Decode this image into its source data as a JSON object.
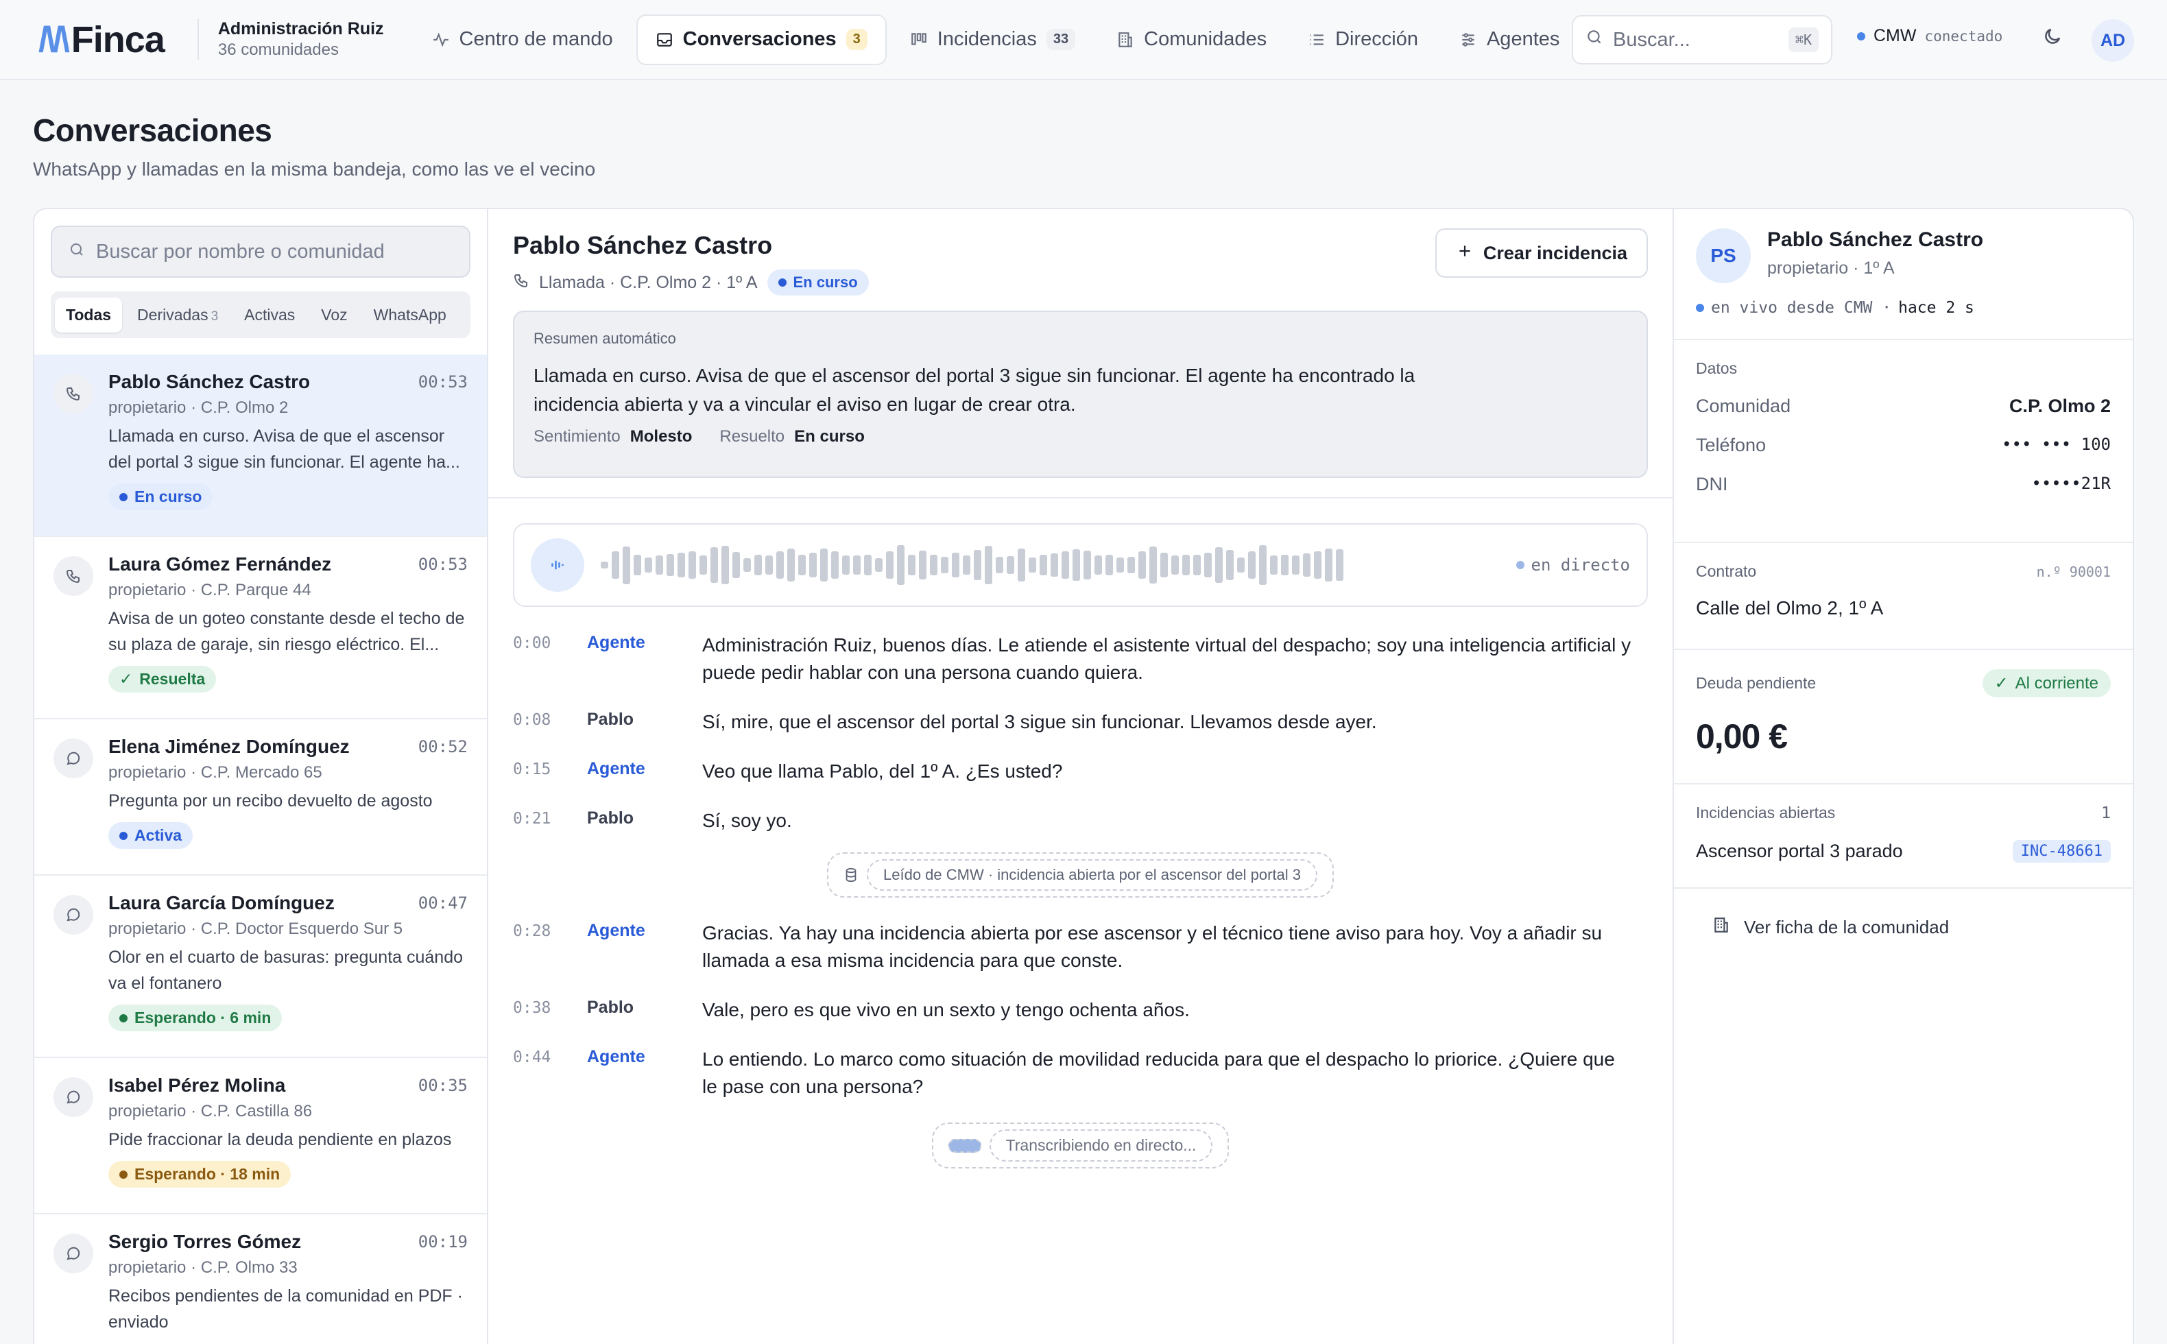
{
  "brand": {
    "logo_mark": "/\\/\\",
    "name": "Finca"
  },
  "org": {
    "name": "Administración Ruiz",
    "communities": "36 comunidades"
  },
  "nav": {
    "items": [
      {
        "label": "Centro de mando",
        "icon": "pulse-icon"
      },
      {
        "label": "Conversaciones",
        "icon": "inbox-icon",
        "badge": "3"
      },
      {
        "label": "Incidencias",
        "icon": "kanban-icon",
        "badge": "33"
      },
      {
        "label": "Comunidades",
        "icon": "building-icon"
      },
      {
        "label": "Dirección",
        "icon": "list-icon"
      },
      {
        "label": "Agentes",
        "icon": "sliders-icon"
      }
    ]
  },
  "search": {
    "placeholder": "Buscar...",
    "shortcut": "⌘K"
  },
  "connection": {
    "name": "CMW",
    "status": "conectado"
  },
  "user_initials": "AD",
  "page": {
    "title": "Conversaciones",
    "subtitle": "WhatsApp y llamadas en la misma bandeja, como las ve el vecino"
  },
  "list": {
    "search_placeholder": "Buscar por nombre o comunidad",
    "filters": [
      {
        "label": "Todas"
      },
      {
        "label": "Derivadas",
        "count": "3"
      },
      {
        "label": "Activas"
      },
      {
        "label": "Voz"
      },
      {
        "label": "WhatsApp"
      }
    ],
    "items": [
      {
        "name": "Pablo Sánchez Castro",
        "time": "00:53",
        "meta": "propietario · C.P. Olmo 2",
        "text": "Llamada en curso. Avisa de que el ascensor del portal 3 sigue sin funcionar. El agente ha...",
        "status": "En curso",
        "channel": "phone-icon"
      },
      {
        "name": "Laura Gómez Fernández",
        "time": "00:53",
        "meta": "propietario · C.P. Parque 44",
        "text": "Avisa de un goteo constante desde el techo de su plaza de garaje, sin riesgo eléctrico. El...",
        "status": "Resuelta",
        "channel": "phone-icon"
      },
      {
        "name": "Elena Jiménez Domínguez",
        "time": "00:52",
        "meta": "propietario · C.P. Mercado 65",
        "text": "Pregunta por un recibo devuelto de agosto",
        "status": "Activa",
        "channel": "chat-icon"
      },
      {
        "name": "Laura García Domínguez",
        "time": "00:47",
        "meta": "propietario · C.P. Doctor Esquerdo Sur 5",
        "text": "Olor en el cuarto de basuras: pregunta cuándo va el fontanero",
        "status": "Esperando · 6 min",
        "channel": "chat-icon"
      },
      {
        "name": "Isabel Pérez Molina",
        "time": "00:35",
        "meta": "propietario · C.P. Castilla 86",
        "text": "Pide fraccionar la deuda pendiente en plazos",
        "status": "Esperando · 18 min",
        "channel": "chat-icon"
      },
      {
        "name": "Sergio Torres Gómez",
        "time": "00:19",
        "meta": "propietario · C.P. Olmo 33",
        "text": "Recibos pendientes de la comunidad en PDF · enviado",
        "status": "",
        "channel": "chat-icon"
      }
    ]
  },
  "conversation": {
    "name": "Pablo Sánchez Castro",
    "meta": "Llamada · C.P. Olmo 2 · 1º A",
    "status": "En curso",
    "create_button": "Crear incidencia",
    "summary": {
      "label": "Resumen automático",
      "body": "Llamada en curso. Avisa de que el ascensor del portal 3 sigue sin funcionar. El agente ha encontrado la incidencia abierta y va a vincular el aviso en lugar de crear otra.",
      "sentiment_label": "Sentimiento",
      "sentiment": "Molesto",
      "resolved_label": "Resuelto",
      "resolved": "En curso"
    },
    "audio_live": "en directo",
    "lines": [
      {
        "ts": "0:00",
        "speaker": "Agente",
        "role": "agent",
        "text": "Administración Ruiz, buenos días. Le atiende el asistente virtual del despacho; soy una inteligencia artificial y puede pedir hablar con una persona cuando quiera."
      },
      {
        "ts": "0:08",
        "speaker": "Pablo",
        "role": "user",
        "text": "Sí, mire, que el ascensor del portal 3 sigue sin funcionar. Llevamos desde ayer."
      },
      {
        "ts": "0:15",
        "speaker": "Agente",
        "role": "agent",
        "text": "Veo que llama Pablo, del 1º A. ¿Es usted?"
      },
      {
        "ts": "0:21",
        "speaker": "Pablo",
        "role": "user",
        "text": "Sí, soy yo."
      },
      {
        "ts": "0:28",
        "speaker": "Agente",
        "role": "agent",
        "text": "Gracias. Ya hay una incidencia abierta por ese ascensor y el técnico tiene aviso para hoy. Voy a añadir su llamada a esa misma incidencia para que conste."
      },
      {
        "ts": "0:38",
        "speaker": "Pablo",
        "role": "user",
        "text": "Vale, pero es que vivo en un sexto y tengo ochenta años."
      },
      {
        "ts": "0:44",
        "speaker": "Agente",
        "role": "agent",
        "text": "Lo entiendo. Lo marco como situación de movilidad reducida para que el despacho lo priorice. ¿Quiere que le pase con una persona?"
      }
    ],
    "system_note": "Leído de CMW · incidencia abierta por el ascensor del portal 3",
    "pending": "Transcribiendo en directo..."
  },
  "contact": {
    "initials": "PS",
    "name": "Pablo Sánchez Castro",
    "role": "propietario · 1º A",
    "live": "en vivo desde CMW ·",
    "live_time": "hace 2 s",
    "data_label": "Datos",
    "fields": [
      {
        "k": "Comunidad",
        "v": "C.P. Olmo 2"
      },
      {
        "k": "Teléfono",
        "v": "••• ••• 100"
      },
      {
        "k": "DNI",
        "v": "•••••21R"
      }
    ],
    "contract_label": "Contrato",
    "contract_no": "n.º 90001",
    "address": "Calle del Olmo 2, 1º A",
    "debt_label": "Deuda pendiente",
    "debt_status": "Al corriente",
    "debt_value": "0,00 €",
    "incidents_label": "Incidencias abiertas",
    "incidents_count": "1",
    "incident_title": "Ascensor portal 3 parado",
    "incident_id": "INC-48661",
    "community_link": "Ver ficha de la comunidad"
  },
  "colors": {
    "accent": "#2a5bd7",
    "selected_bg": "#eaf1fd",
    "success": "#1f7a45",
    "warning": "#8a5a10"
  }
}
